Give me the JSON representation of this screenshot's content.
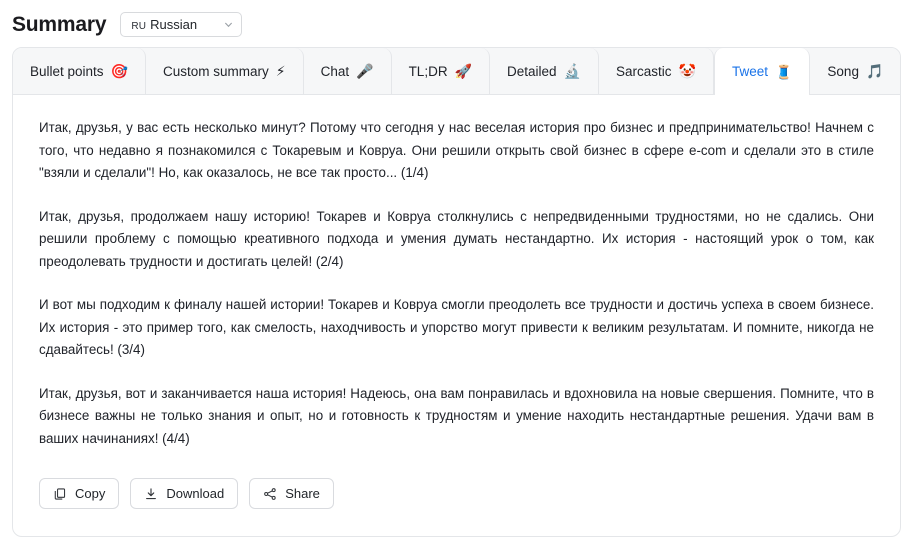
{
  "header": {
    "title": "Summary",
    "language_select": {
      "code": "ru",
      "name": "Russian",
      "chevron_icon": "chevron-down-icon"
    }
  },
  "tabs": [
    {
      "label": "Bullet points",
      "emoji": "🎯",
      "icon_name": "target-emoji",
      "active": false
    },
    {
      "label": "Custom summary",
      "emoji": "⚡",
      "icon_name": "lightning-emoji",
      "active": false
    },
    {
      "label": "Chat",
      "emoji": "🎤",
      "icon_name": "microphone-emoji",
      "active": false
    },
    {
      "label": "TL;DR",
      "emoji": "🚀",
      "icon_name": "rocket-emoji",
      "active": false
    },
    {
      "label": "Detailed",
      "emoji": "🔬",
      "icon_name": "microscope-emoji",
      "active": false
    },
    {
      "label": "Sarcastic",
      "emoji": "🤡",
      "icon_name": "clown-emoji",
      "active": false
    },
    {
      "label": "Tweet",
      "emoji": "🧵",
      "icon_name": "thread-spool-emoji",
      "active": true
    },
    {
      "label": "Song",
      "emoji": "🎵",
      "icon_name": "music-note-emoji",
      "active": false
    }
  ],
  "summary": {
    "paragraphs": [
      "Итак, друзья, у вас есть несколько минут? Потому что сегодня у нас веселая история про бизнес и предпринимательство! Начнем с того, что недавно я познакомился с Токаревым и Ковруа. Они решили открыть свой бизнес в сфере e-com и сделали это в стиле \"взяли и сделали\"! Но, как оказалось, не все так просто... (1/4)",
      "Итак, друзья, продолжаем нашу историю! Токарев и Ковруа столкнулись с непредвиденными трудностями, но не сдались. Они решили проблему с помощью креативного подхода и умения думать нестандартно. Их история - настоящий урок о том, как преодолевать трудности и достигать целей! (2/4)",
      "И вот мы подходим к финалу нашей истории! Токарев и Ковруа смогли преодолеть все трудности и достичь успеха в своем бизнесе. Их история - это пример того, как смелость, находчивость и упорство могут привести к великим результатам. И помните, никогда не сдавайтесь! (3/4)",
      "Итак, друзья, вот и заканчивается наша история! Надеюсь, она вам понравилась и вдохновила на новые свершения. Помните, что в бизнесе важны не только знания и опыт, но и готовность к трудностям и умение находить нестандартные решения. Удачи вам в ваших начинаниях! (4/4)"
    ]
  },
  "actions": [
    {
      "label": "Copy",
      "icon_name": "copy-icon"
    },
    {
      "label": "Download",
      "icon_name": "download-icon"
    },
    {
      "label": "Share",
      "icon_name": "share-icon"
    }
  ],
  "colors": {
    "accent": "#1a73e8",
    "text": "#20232a",
    "border": "#e4e6e9",
    "tabbar_bg": "#f6f7f8"
  }
}
